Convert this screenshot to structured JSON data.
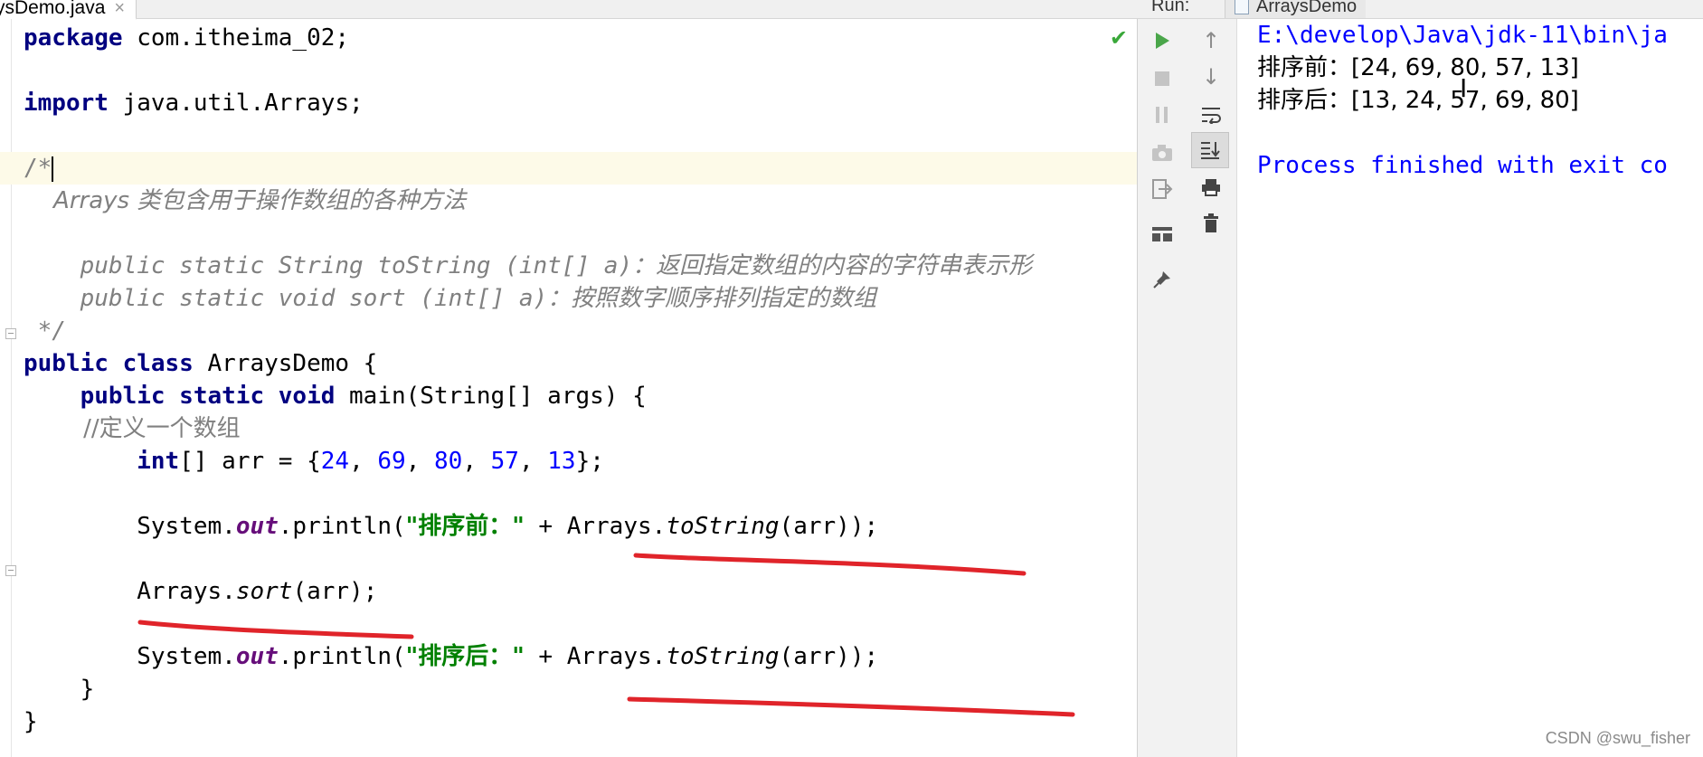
{
  "editor": {
    "tab_label": "ysDemo.java",
    "tab_close": "×"
  },
  "code": {
    "l1_kw": "package",
    "l1_rest": " com.itheima_02;",
    "l3_kw": "import",
    "l3_rest": " java.util.Arrays;",
    "l5": "/*",
    "l6": "    Arrays 类包含用于操作数组的各种方法",
    "l8": "    public static String toString (int[] a)：返回指定数组的内容的字符串表示形",
    "l9": "    public static void sort (int[] a)：按照数字顺序排列指定的数组",
    "l10": " */",
    "l11_kw": "public class",
    "l11_rest": " ArraysDemo {",
    "l12_kw": "    public static void",
    "l12_rest": " main(String[] args) {",
    "l13": "        //定义一个数组",
    "l14_kw": "int",
    "l14_a": "[] arr = {",
    "nums": [
      "24",
      "69",
      "80",
      "57",
      "13"
    ],
    "l14_end": "};",
    "l16_a": "        System.",
    "out": "out",
    "l16_b": ".println(",
    "str_before": "\"排序前：\"",
    "l16_c": " + Arrays.",
    "tostring": "toString",
    "l16_d": "(arr));",
    "l18_a": "        Arrays.",
    "sort": "sort",
    "l18_b": "(arr);",
    "str_after": "\"排序后：\"",
    "l22": "    }",
    "l23": "}"
  },
  "run": {
    "label": "Run:",
    "tab": "ArraysDemo",
    "console_path": "E:\\develop\\Java\\jdk-11\\bin\\ja",
    "console_before": "排序前：[24, 69, 80, 57, 13]",
    "console_after": "排序后：[13, 24, 57, 69, 80]",
    "console_exit": "Process finished with exit co"
  },
  "watermark": "CSDN @swu_fisher",
  "colors": {
    "keyword": "#000080",
    "comment": "#808080",
    "number": "#0000ff",
    "string": "#008000",
    "field": "#660e7a",
    "annotation_ink": "#e0242a",
    "run_green": "#4aa64a"
  }
}
